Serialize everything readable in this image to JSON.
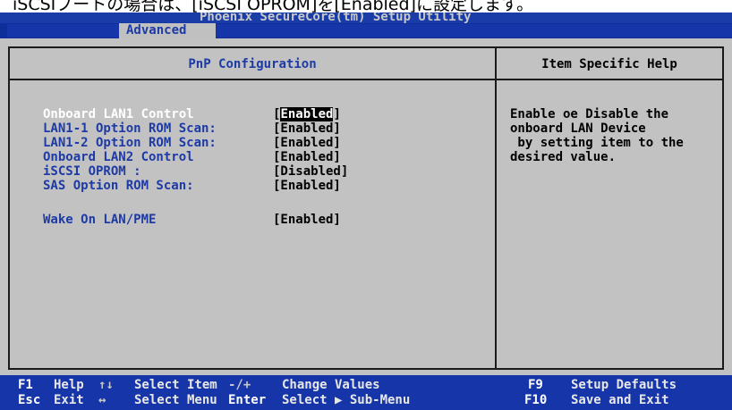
{
  "caption": "iSCSIブートの場合は、[iSCSI OPROM]を[Enabled]に設定します。",
  "title_bar": "Phoenix SecureCore(tm) Setup Utility",
  "menu": {
    "active_tab": "Advanced"
  },
  "section_title": "PnP Configuration",
  "help": {
    "title": "Item Specific Help",
    "lines": [
      "Enable oe Disable the",
      "onboard LAN Device",
      " by setting item to the",
      "desired value."
    ]
  },
  "settings": [
    {
      "label": "Onboard LAN1 Control",
      "value": "Enabled",
      "selected": true
    },
    {
      "label": "LAN1-1 Option ROM Scan:",
      "value": "[Enabled]"
    },
    {
      "label": "LAN1-2 Option ROM Scan:",
      "value": "[Enabled]"
    },
    {
      "label": "Onboard LAN2 Control",
      "value": "[Enabled]"
    },
    {
      "label": "iSCSI OPROM :",
      "value": "[Disabled]"
    },
    {
      "label": "SAS Option ROM Scan:",
      "value": "[Enabled]"
    },
    {
      "label": "Wake On LAN/PME",
      "value": "[Enabled]"
    }
  ],
  "footer": {
    "f1_key": "F1",
    "f1_desc": "Help",
    "updown_sym": "↑↓",
    "updown_desc": "Select Item",
    "plusminus_sym": "-/+",
    "plusminus_desc": "Change Values",
    "f9_key": "F9",
    "f9_desc": "Setup Defaults",
    "esc_key": "Esc",
    "esc_desc": "Exit",
    "leftright_sym": "↔",
    "leftright_desc": "Select Menu",
    "enter_key": "Enter",
    "enter_desc": "Select ▶ Sub-Menu",
    "f10_key": "F10",
    "f10_desc": "Save and Exit"
  }
}
